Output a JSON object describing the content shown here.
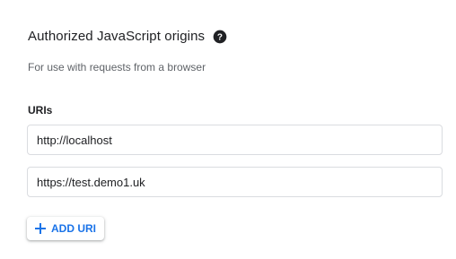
{
  "section": {
    "title": "Authorized JavaScript origins",
    "help_icon": "help-circle-icon",
    "description": "For use with requests from a browser"
  },
  "uris": {
    "label": "URIs",
    "items": [
      {
        "value": "http://localhost"
      },
      {
        "value": "https://test.demo1.uk"
      }
    ]
  },
  "add_button": {
    "icon": "plus-icon",
    "label": "ADD URI"
  },
  "colors": {
    "accent": "#1a73e8",
    "text_primary": "#202124",
    "text_secondary": "#5f6368",
    "border": "#dadce0"
  }
}
